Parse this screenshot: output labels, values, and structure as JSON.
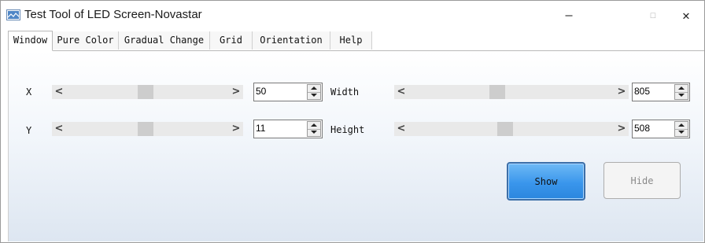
{
  "window": {
    "title": "Test Tool of LED Screen-Novastar",
    "icon": "led-screen-icon"
  },
  "window_controls": {
    "minimize": "—",
    "maximize": "☐",
    "close": "✕"
  },
  "menu": [
    "Window",
    "Pure Color",
    "Gradual Change",
    "Grid",
    "Orientation",
    "Help"
  ],
  "active_tab": "Window",
  "controls": {
    "x": {
      "label": "X",
      "value": "50",
      "slider_fraction": 0.44
    },
    "y": {
      "label": "Y",
      "value": "11",
      "slider_fraction": 0.44
    },
    "width": {
      "label": "Width",
      "value": "805",
      "slider_fraction": 0.44
    },
    "height": {
      "label": "Height",
      "value": "508",
      "slider_fraction": 0.46
    }
  },
  "buttons": {
    "show": "Show",
    "hide": "Hide"
  },
  "scroll_arrows": {
    "left": "<",
    "right": ">"
  }
}
